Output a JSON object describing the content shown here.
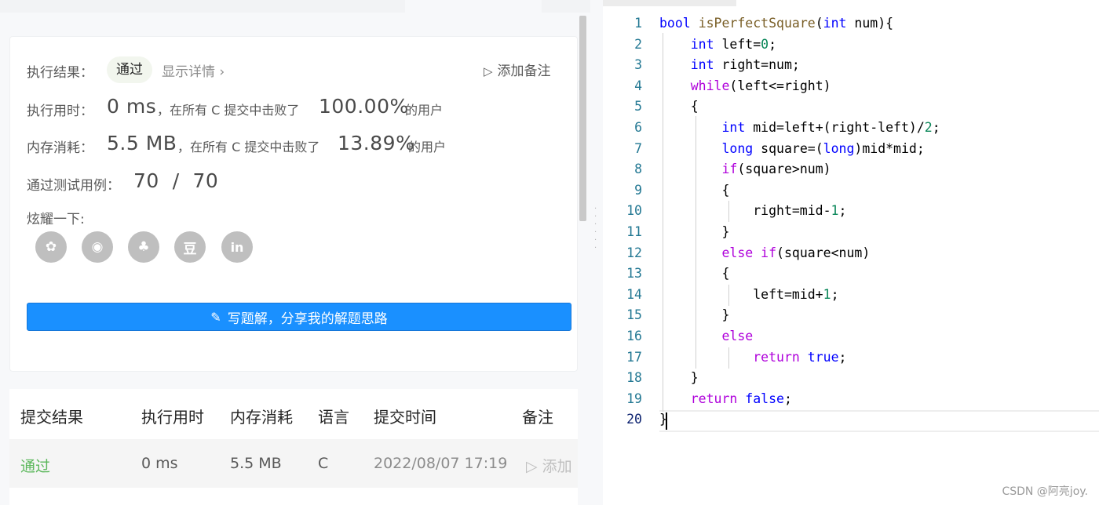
{
  "result": {
    "label": "执行结果：",
    "status": "通过",
    "details_link": "显示详情 ›",
    "add_note": "添加备注",
    "runtime_label": "执行用时：",
    "runtime_value": "0 ms",
    "runtime_middle": "，在所有 C 提交中击败了",
    "runtime_percent": "100.00%",
    "runtime_suffix": "的用户",
    "memory_label": "内存消耗：",
    "memory_value": "5.5 MB",
    "memory_middle": "，在所有 C 提交中击败了",
    "memory_percent": "13.89%",
    "memory_suffix": "的用户",
    "tests_label": "通过测试用例：",
    "tests_value": "70  /  70",
    "share_label": "炫耀一下:",
    "share_icons": [
      "wechat-icon",
      "weibo-icon",
      "qq-icon",
      "douban-icon",
      "linkedin-icon"
    ],
    "share_glyphs": [
      "✿",
      "◉",
      "♣",
      "豆",
      "in"
    ],
    "solution_button": "写题解，分享我的解题思路"
  },
  "submissions": {
    "headers": [
      "提交结果",
      "执行用时",
      "内存消耗",
      "语言",
      "提交时间",
      "备注"
    ],
    "rows": [
      {
        "result": "通过",
        "runtime": "0 ms",
        "memory": "5.5 MB",
        "language": "C",
        "time": "2022/08/07 17:19",
        "note": "添加"
      }
    ]
  },
  "editor": {
    "line_numbers": [
      "1",
      "2",
      "3",
      "4",
      "5",
      "6",
      "7",
      "8",
      "9",
      "10",
      "11",
      "12",
      "13",
      "14",
      "15",
      "16",
      "17",
      "18",
      "19",
      "20"
    ]
  },
  "watermark": "CSDN @阿亮joy.",
  "colors": {
    "accent_blue": "#1a90ff",
    "pass_green": "#5cb85c",
    "keyword": "#0000ff",
    "control": "#af00db",
    "number": "#098658",
    "line_number": "#237893"
  }
}
